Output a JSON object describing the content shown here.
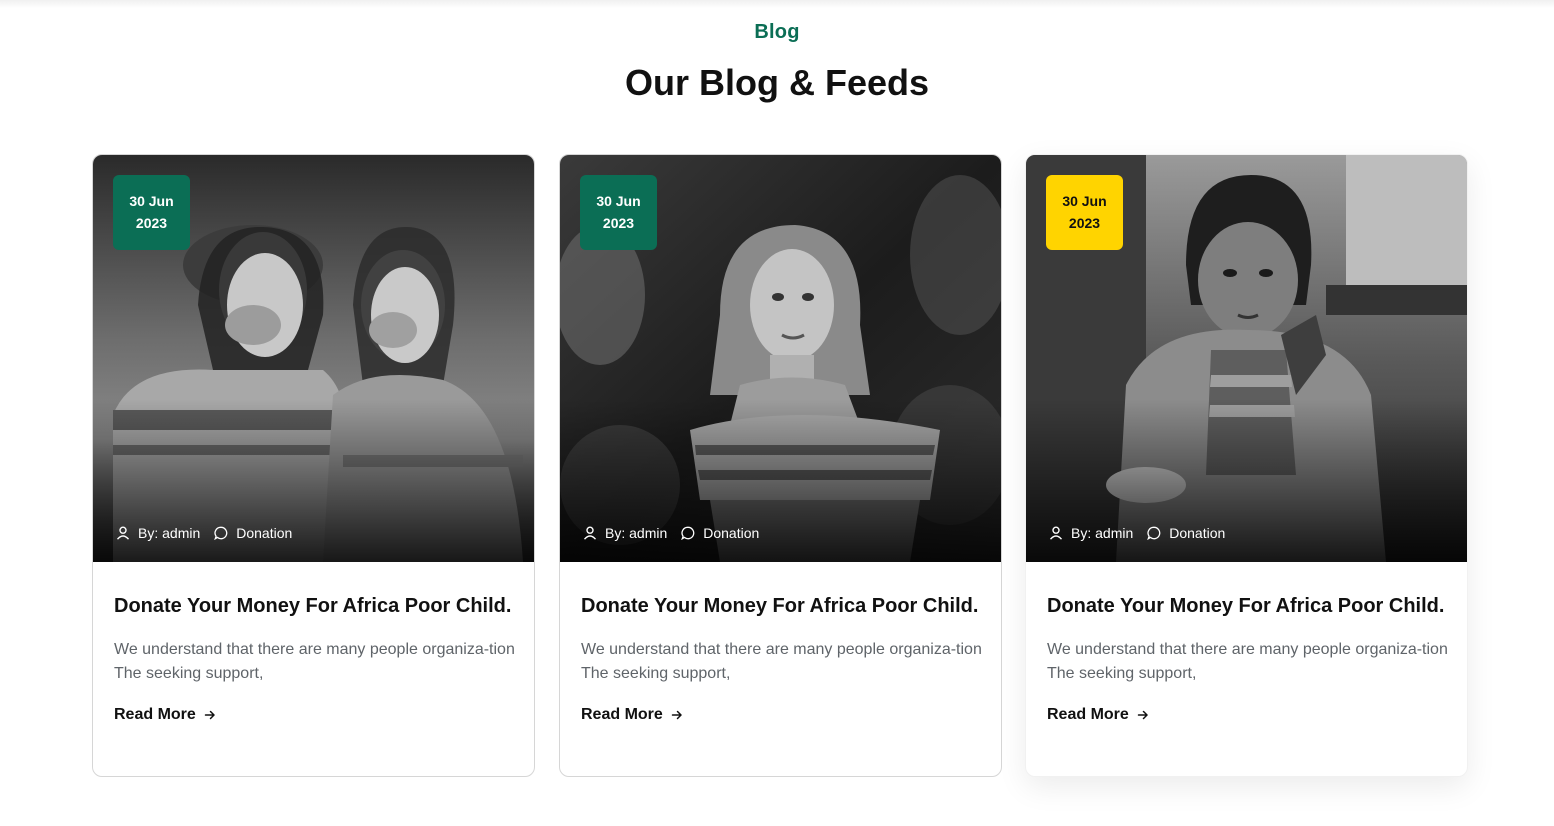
{
  "section": {
    "eyebrow": "Blog",
    "title": "Our Blog & Feeds"
  },
  "colors": {
    "accent_green": "#0b6e55",
    "badge_yellow": "#ffd400"
  },
  "cards": [
    {
      "date_day": "30 Jun",
      "date_year": "2023",
      "badge_color": "#0b6e55",
      "badge_text_color": "#ffffff",
      "author": "By: admin",
      "category": "Donation",
      "title": "Donate Your Money For Africa Poor Child.",
      "excerpt": "We understand that there are many people organiza-tion The seeking support,",
      "read_more": "Read More",
      "image_icon": "photo-two-girls-laughing"
    },
    {
      "date_day": "30 Jun",
      "date_year": "2023",
      "badge_color": "#0b6e55",
      "badge_text_color": "#ffffff",
      "author": "By: admin",
      "category": "Donation",
      "title": "Donate Your Money For Africa Poor Child.",
      "excerpt": "We understand that there are many people organiza-tion The seeking support,",
      "read_more": "Read More",
      "image_icon": "photo-girl-portrait"
    },
    {
      "date_day": "30 Jun",
      "date_year": "2023",
      "badge_color": "#ffd400",
      "badge_text_color": "#111111",
      "author": "By: admin",
      "category": "Donation",
      "title": "Donate Your Money For Africa Poor Child.",
      "excerpt": "We understand that there are many people organiza-tion The seeking support,",
      "read_more": "Read More",
      "image_icon": "photo-boy-portrait"
    }
  ]
}
